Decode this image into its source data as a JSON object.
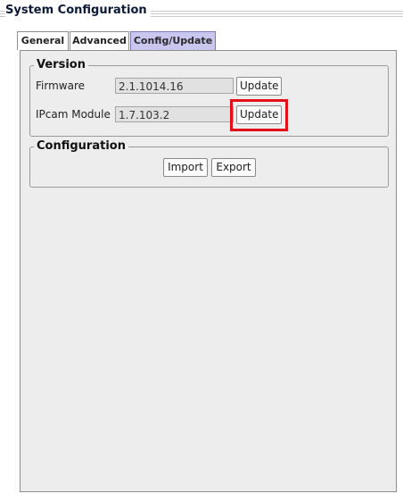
{
  "window": {
    "title": "System Configuration"
  },
  "tabs": [
    {
      "label": "General"
    },
    {
      "label": "Advanced"
    },
    {
      "label": "Config/Update",
      "selected": true
    }
  ],
  "version_group": {
    "title": "Version",
    "rows": [
      {
        "label": "Firmware",
        "value": "2.1.1014.16",
        "button": "Update"
      },
      {
        "label": "IPcam Module",
        "value": "1.7.103.2",
        "button": "Update"
      }
    ]
  },
  "config_group": {
    "title": "Configuration",
    "import_label": "Import",
    "export_label": "Export"
  },
  "colors": {
    "selected_tab": "#c9c6f0",
    "highlight": "#e3101a",
    "panel_bg": "#ededed"
  }
}
